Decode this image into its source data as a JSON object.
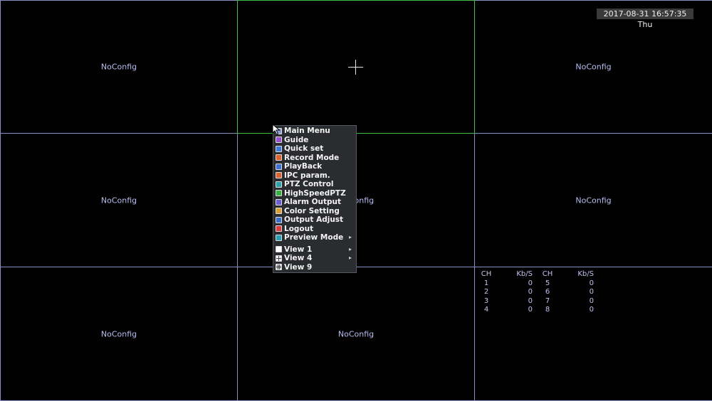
{
  "clock": "2017-08-31 16:57:35 Thu",
  "grid": {
    "cells": [
      {
        "label": "NoConfig",
        "selected": false
      },
      {
        "label": "",
        "selected": true
      },
      {
        "label": "NoConfig",
        "selected": false
      },
      {
        "label": "NoConfig",
        "selected": false
      },
      {
        "label": "NoConfig",
        "selected": false
      },
      {
        "label": "NoConfig",
        "selected": false
      },
      {
        "label": "NoConfig",
        "selected": false
      },
      {
        "label": "NoConfig",
        "selected": false
      },
      {
        "label": "",
        "selected": false
      }
    ]
  },
  "context_menu": {
    "items": [
      {
        "label": "Main Menu",
        "icon": "main-menu-icon",
        "color": "#8aa0d8"
      },
      {
        "label": "Guide",
        "icon": "guide-icon",
        "color": "#9a4fd0"
      },
      {
        "label": "Quick set",
        "icon": "quick-set-icon",
        "color": "#3a7be0"
      },
      {
        "label": "Record Mode",
        "icon": "record-mode-icon",
        "color": "#e0612e"
      },
      {
        "label": "PlayBack",
        "icon": "playback-icon",
        "color": "#3f6fd8"
      },
      {
        "label": "IPC param.",
        "icon": "ipc-param-icon",
        "color": "#e06030"
      },
      {
        "label": "PTZ Control",
        "icon": "ptz-control-icon",
        "color": "#2aa0a8"
      },
      {
        "label": "HighSpeedPTZ",
        "icon": "high-speed-ptz-icon",
        "color": "#38b040"
      },
      {
        "label": "Alarm Output",
        "icon": "alarm-output-icon",
        "color": "#6a5fd8"
      },
      {
        "label": "Color Setting",
        "icon": "color-setting-icon",
        "color": "#d8a030"
      },
      {
        "label": "Output Adjust",
        "icon": "output-adjust-icon",
        "color": "#3a6fd0"
      },
      {
        "label": "Logout",
        "icon": "logout-icon",
        "color": "#e03a3a"
      },
      {
        "label": "Preview Mode",
        "icon": "preview-mode-icon",
        "color": "#2aa0b8",
        "submenu": true
      }
    ],
    "view_items": [
      {
        "label": "View 1",
        "icon": "view-1-icon",
        "kind": "view1",
        "submenu": true
      },
      {
        "label": "View 4",
        "icon": "view-4-icon",
        "kind": "view4",
        "submenu": true
      },
      {
        "label": "View 9",
        "icon": "view-9-icon",
        "kind": "view9",
        "submenu": false
      }
    ],
    "submenu_arrow": "▸"
  },
  "bitrate_table": {
    "headers": [
      "CH",
      "Kb/S",
      "CH",
      "Kb/S"
    ],
    "rows": [
      [
        "1",
        "0",
        "5",
        "0"
      ],
      [
        "2",
        "0",
        "6",
        "0"
      ],
      [
        "3",
        "0",
        "7",
        "0"
      ],
      [
        "4",
        "0",
        "8",
        "0"
      ]
    ]
  }
}
